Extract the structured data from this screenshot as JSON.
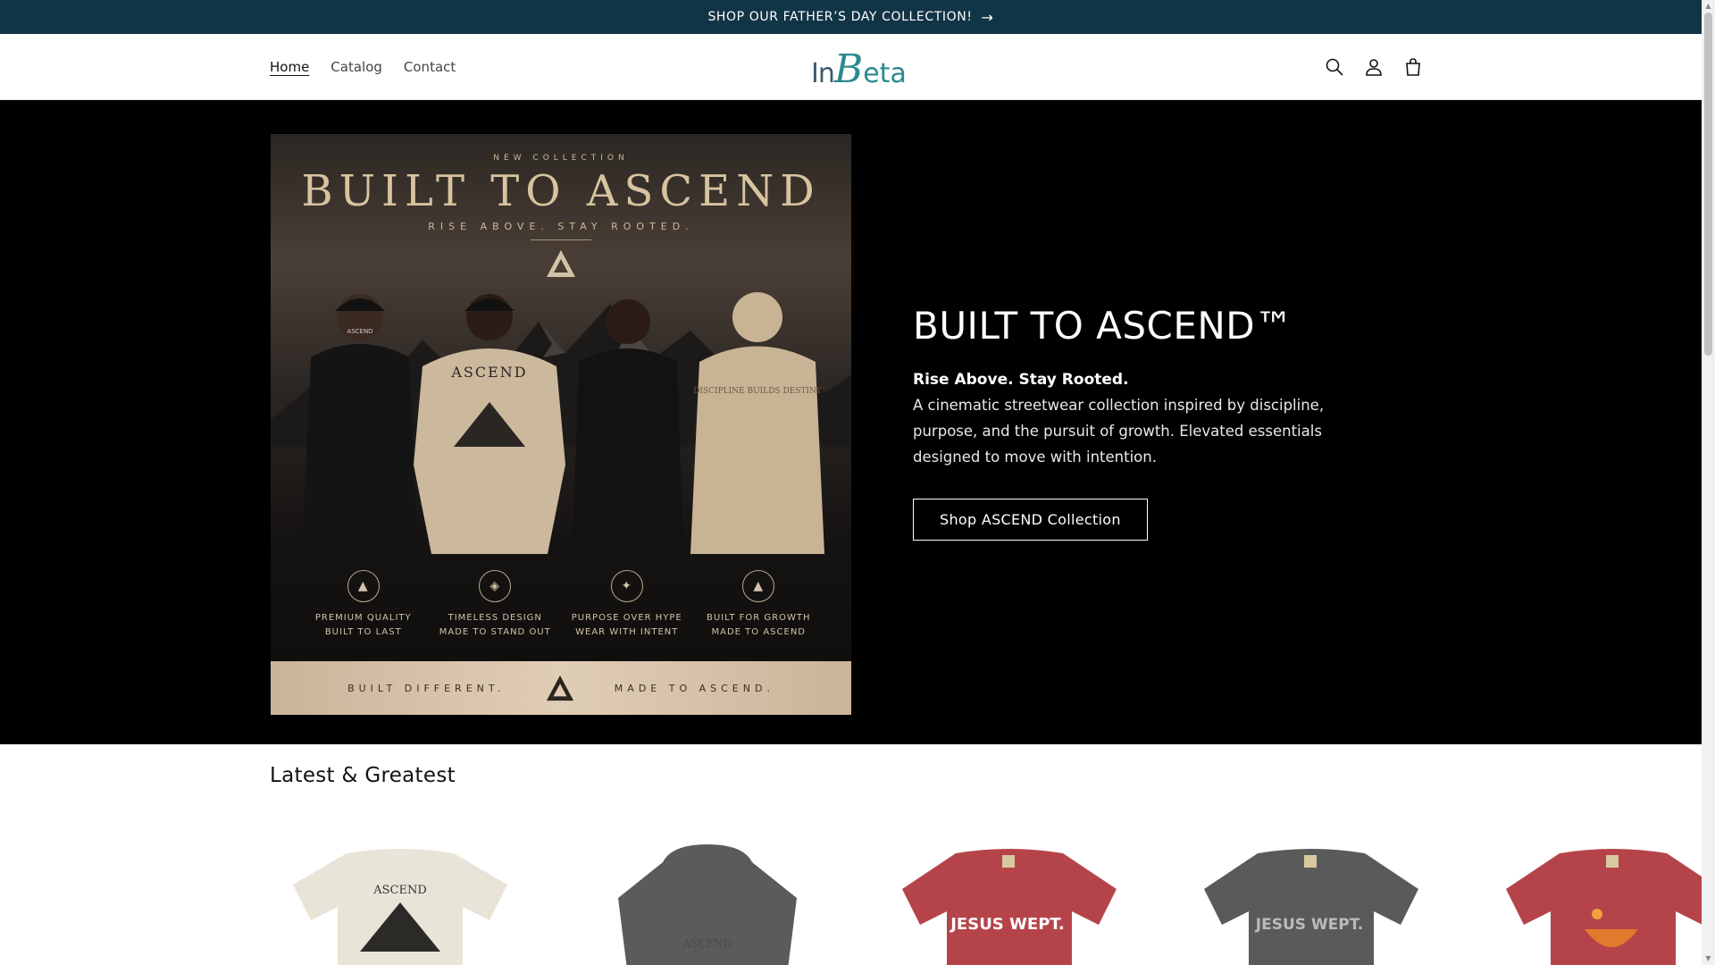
{
  "announcement": {
    "text": "SHOP OUR FATHER’S DAY COLLECTION!",
    "arrow": "→"
  },
  "nav": {
    "items": [
      {
        "label": "Home",
        "active": true
      },
      {
        "label": "Catalog"
      },
      {
        "label": "Contact"
      }
    ]
  },
  "logo": {
    "part1": "In",
    "part2": "B",
    "part3": "eta"
  },
  "header_icons": [
    "search-icon",
    "account-icon",
    "cart-icon"
  ],
  "poster": {
    "kicker": "NEW COLLECTION",
    "title": "BUILT TO ASCEND",
    "subtitle": "RISE ABOVE. STAY ROOTED.",
    "shirt_text_1": "ASCEND",
    "shirt_text_2": "ASCEND",
    "shirt_text_3": "DISCIPLINE BUILDS DESTINY",
    "badges": [
      {
        "line1": "PREMIUM QUALITY",
        "line2": "BUILT TO LAST"
      },
      {
        "line1": "TIMELESS DESIGN",
        "line2": "MADE TO STAND OUT"
      },
      {
        "line1": "PURPOSE OVER HYPE",
        "line2": "WEAR WITH INTENT"
      },
      {
        "line1": "BUILT FOR GROWTH",
        "line2": "MADE TO ASCEND"
      }
    ],
    "strip_left": "BUILT DIFFERENT.",
    "strip_right": "MADE TO ASCEND."
  },
  "hero": {
    "title": "BUILT TO ASCEND™",
    "lead": "Rise Above. Stay Rooted.",
    "description": "A cinematic streetwear collection inspired by discipline, purpose, and the pursuit of growth. Elevated essentials designed to move with intention.",
    "button": "Shop ASCEND Collection"
  },
  "section_title": "Latest & Greatest",
  "products": [
    {
      "name": "ASCEND tee",
      "color": "#e9e4d8",
      "print": "ASCEND"
    },
    {
      "name": "ASCEND hoodie",
      "color": "#5b5b5b",
      "print": "ASCEND"
    },
    {
      "name": "JESUS WEPT tee red",
      "color": "#b5444a",
      "print": "JESUS WEPT."
    },
    {
      "name": "JESUS WEPT tee gray",
      "color": "#5a5a5a",
      "print": "JESUS WEPT."
    },
    {
      "name": "Graphic tee red",
      "color": "#b5444a",
      "print": ""
    }
  ]
}
